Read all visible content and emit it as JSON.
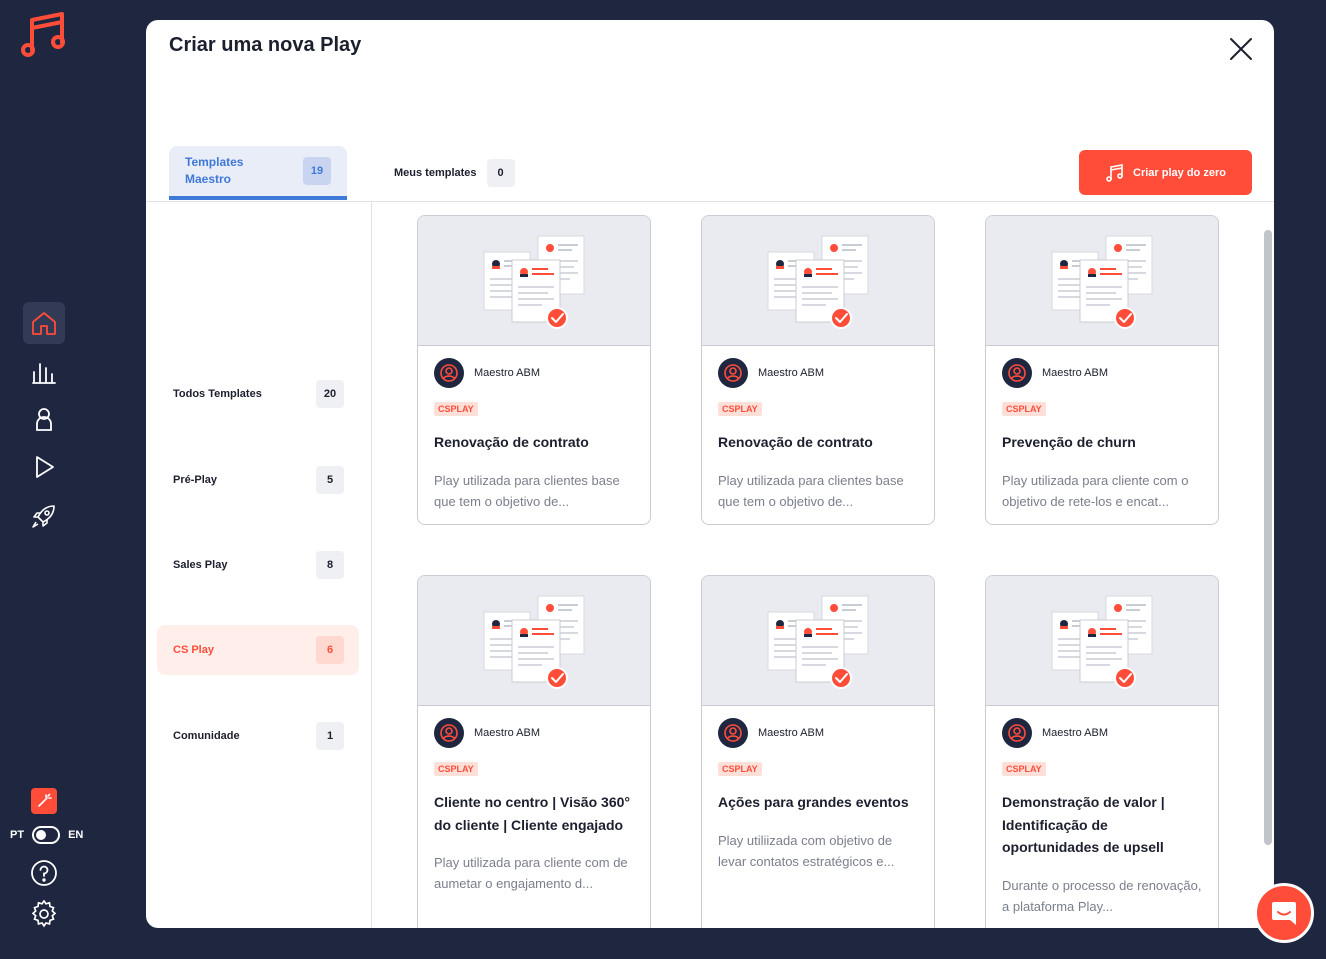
{
  "sidebar": {
    "lang_left": "PT",
    "lang_right": "EN",
    "nav_icons": [
      "home-icon",
      "chart-icon",
      "user-icon",
      "play-icon",
      "rocket-icon"
    ]
  },
  "modal": {
    "title": "Criar uma nova Play",
    "tabs": [
      {
        "label": "Templates Maestro",
        "count": "19"
      },
      {
        "label": "Meus templates",
        "count": "0"
      }
    ],
    "create_button": "Criar play do zero"
  },
  "categories": [
    {
      "label": "Todos Templates",
      "count": "20"
    },
    {
      "label": "Pré-Play",
      "count": "5"
    },
    {
      "label": "Sales Play",
      "count": "8"
    },
    {
      "label": "CS Play",
      "count": "6"
    },
    {
      "label": "Comunidade",
      "count": "1"
    }
  ],
  "cards": [
    {
      "author": "Maestro ABM",
      "tag": "CSPLAY",
      "title": "Renovação de contrato",
      "desc": "Play utilizada para clientes base que tem o objetivo de..."
    },
    {
      "author": "Maestro ABM",
      "tag": "CSPLAY",
      "title": "Renovação de contrato",
      "desc": "Play utilizada para clientes base que tem o objetivo de..."
    },
    {
      "author": "Maestro ABM",
      "tag": "CSPLAY",
      "title": "Prevenção de churn",
      "desc": "Play utilizada para cliente com o objetivo de rete-los e encat..."
    },
    {
      "author": "Maestro ABM",
      "tag": "CSPLAY",
      "title": "Cliente no centro | Visão 360° do cliente | Cliente engajado",
      "desc": "Play utilizada para cliente com de aumetar o engajamento d..."
    },
    {
      "author": "Maestro ABM",
      "tag": "CSPLAY",
      "title": "Ações para grandes eventos",
      "desc": "Play utiliizada com objetivo de levar contatos estratégicos e..."
    },
    {
      "author": "Maestro ABM",
      "tag": "CSPLAY",
      "title": "Demonstração de valor | Identificação de oportunidades de upsell",
      "desc": "Durante o processo de renovação, a plataforma Play..."
    }
  ],
  "colors": {
    "accent": "#ff4d3a",
    "sidebar_bg": "#1e2640",
    "tab_blue": "#3e78d8"
  }
}
